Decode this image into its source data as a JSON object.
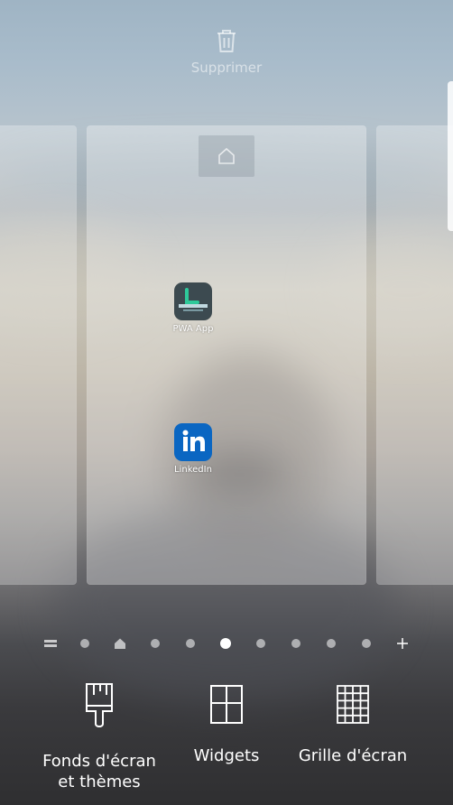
{
  "delete_zone": {
    "label": "Supprimer",
    "icon": "trash-icon"
  },
  "home_screen": {
    "apps": [
      {
        "label": "PWA App",
        "icon": "pwa-app-icon"
      },
      {
        "label": "LinkedIn",
        "icon": "linkedin-icon"
      }
    ]
  },
  "page_indicator": {
    "pages": 9,
    "active_index": 5,
    "left_icon": "menu-lines-icon",
    "home_icon": "home-icon",
    "right_icon": "plus-icon"
  },
  "bottom_menu": {
    "wallpaper_label": "Fonds d'écran\net thèmes",
    "widgets_label": "Widgets",
    "grid_label": "Grille d'écran"
  },
  "colors": {
    "linkedin_brand": "#0a66c2",
    "text": "#ffffff"
  }
}
